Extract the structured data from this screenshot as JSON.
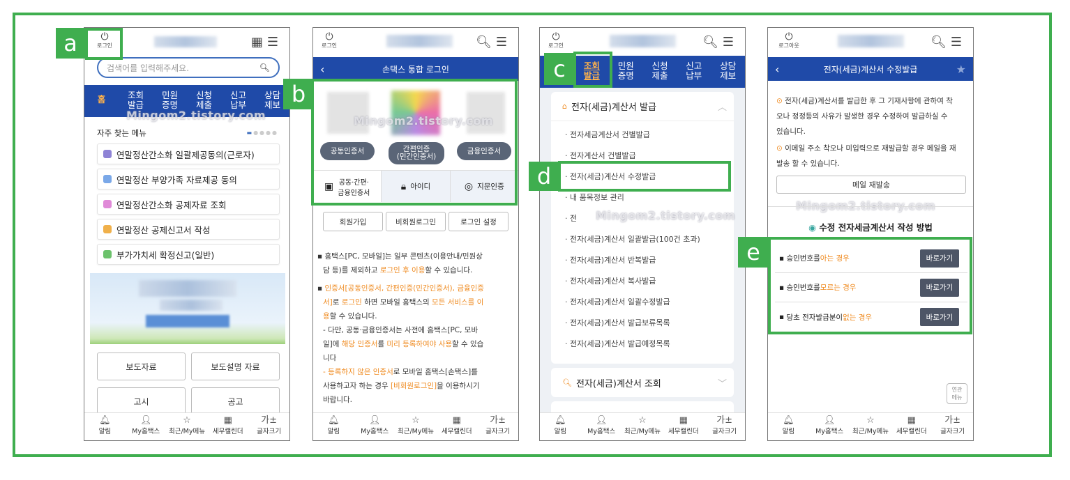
{
  "labels": {
    "a": "a",
    "b": "b",
    "c": "c",
    "d": "d",
    "e": "e"
  },
  "watermark": "Mingom2.tistory.com",
  "common": {
    "login": "로그인",
    "logout": "로그아웃",
    "bottom": [
      {
        "icon": "🔔︎",
        "label": "알림"
      },
      {
        "icon": "👤︎",
        "label": "My홈택스"
      },
      {
        "icon": "☆",
        "label": "최근/My메뉴"
      },
      {
        "icon": "▦",
        "label": "세무캘린더"
      },
      {
        "icon": "가±",
        "label": "글자크기"
      }
    ],
    "nav": [
      "조회\n발급",
      "민원\n증명",
      "신청\n제출",
      "신고\n납부",
      "상담\n제보"
    ]
  },
  "p1": {
    "search_placeholder": "검색어를 입력해주세요.",
    "home": "홈",
    "freq_title": "자주 찾는 메뉴",
    "menus": [
      {
        "label": "연말정산간소화 일괄제공동의(근로자)",
        "color": "#8e83d6"
      },
      {
        "label": "연말정산 부양가족 자료제공 동의",
        "color": "#7aa8e8"
      },
      {
        "label": "연말정산간소화 공제자료 조회",
        "color": "#e08ad8"
      },
      {
        "label": "연말정산 공제신고서 작성",
        "color": "#f0b04a"
      },
      {
        "label": "부가가치세 확정신고(일반)",
        "color": "#6cc26c"
      }
    ],
    "buttons": [
      "보도자료",
      "보도설명 자료",
      "고시",
      "공고"
    ]
  },
  "p2": {
    "title": "손택스 통합 로그인",
    "pills": [
      "공동인증서",
      "간편인증\n(민간인증서)",
      "금융인증서"
    ],
    "tabs": [
      "공동·간편·\n금융인증서",
      "아이디",
      "지문인증"
    ],
    "links": [
      "회원가입",
      "비회원로그인",
      "로그인 설정"
    ],
    "n1a": "홈택스[PC, 모바일]는 일부 콘텐츠(이용안내/민원상",
    "n1b": "담 등)를 제외하고 ",
    "n1c": "로그인 후 이용",
    "n1d": "할 수 있습니다.",
    "n2a": "인증서[공동인증서, 간편인증(민간인증서), 금융인증",
    "n2b": "서]",
    "n2c": "로 ",
    "n2d": "로그인",
    "n2e": " 하면 모바일 홈택스의 ",
    "n2f": "모든 서비스를 이",
    "n2g": "용",
    "n2h": "할 수 있습니다.",
    "n3a": "- 다만, 공동·금융인증서는 사전에 홈택스[PC, 모바",
    "n3b": "일]에 ",
    "n3c": "해당 인증서",
    "n3d": "를 ",
    "n3e": "미리 등록하여야 사용",
    "n3f": "할 수 있습",
    "n3g": "니다",
    "n4a": "- 등록하지 않은 인증서",
    "n4b": "로 모바일 홈택스[손택스]를",
    "n4c": "사용하고자 하는 경우 ",
    "n4d": "[비회원로그인]",
    "n4e": "을 이용하시기",
    "n4f": "바랍니다."
  },
  "p3": {
    "section1": "전자(세금)계산서 발급",
    "items": [
      "전자세금계산서 건별발급",
      "전자계산서 건별발급",
      "전자(세금)계산서 수정발급",
      "내 품목정보 관리",
      "전",
      "전자(세금)계산서 일괄발급(100건 초과)",
      "전자(세금)계산서 반복발급",
      "전자(세금)계산서 복사발급",
      "전자(세금)계산서 일괄수정발급",
      "전자(세금)계산서 발급보류목록",
      "전자(세금)계산서 발급예정목록"
    ],
    "section2": "전자(세금)계산서 조회"
  },
  "p4": {
    "title": "전자(세금)계산서 수정발급",
    "info1a": "전자(세금)계산서를 발급한 후 그 기재사항에 관하여 착",
    "info1b": "오나 정정등의 사유가 발생한 경우 수정하여 발급하실 수",
    "info1c": "있습니다.",
    "info2a": "이메일 주소 착오나 미입력으로 재발급할 경우 메일을 재",
    "info2b": "발송 할 수 있습니다.",
    "resend": "메일 재발송",
    "method_title": "수정 전자세금계산서 작성 방법",
    "rows": [
      {
        "pre": "승인번호를 ",
        "hl": "아는 경우",
        "post": ""
      },
      {
        "pre": "승인번호를 ",
        "hl": "모르는 경우",
        "post": ""
      },
      {
        "pre": "당초 전자발급분이 ",
        "hl": "없는 경우",
        "post": ""
      }
    ],
    "go": "바로가기",
    "related": "연관\n메뉴"
  }
}
